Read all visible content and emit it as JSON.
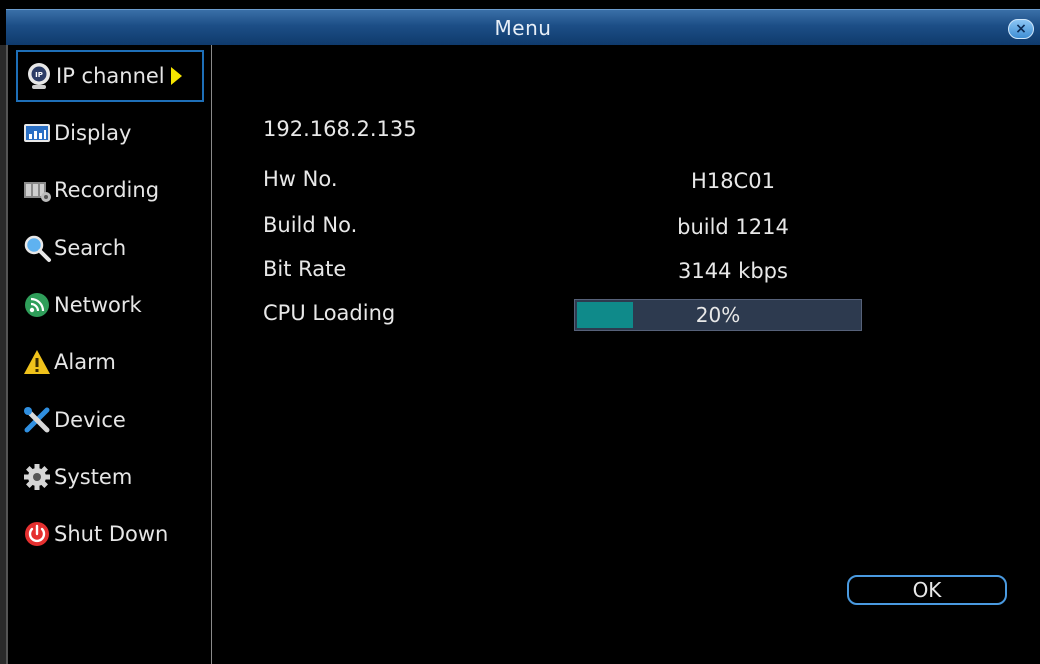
{
  "window": {
    "title": "Menu",
    "close_label": "×"
  },
  "sidebar": {
    "items": [
      {
        "label": "IP channel",
        "icon": "ip-camera-icon",
        "active": true
      },
      {
        "label": "Display",
        "icon": "display-icon"
      },
      {
        "label": "Recording",
        "icon": "recording-icon"
      },
      {
        "label": "Search",
        "icon": "search-icon"
      },
      {
        "label": "Network",
        "icon": "network-icon"
      },
      {
        "label": "Alarm",
        "icon": "alarm-icon"
      },
      {
        "label": "Device",
        "icon": "device-icon"
      },
      {
        "label": "System",
        "icon": "system-icon"
      },
      {
        "label": "Shut Down",
        "icon": "power-icon"
      }
    ]
  },
  "main": {
    "ip_address": "192.168.2.135",
    "hw_label": "Hw No.",
    "hw_value": "H18C01",
    "build_label": "Build No.",
    "build_value": "build 1214",
    "bitrate_label": "Bit Rate",
    "bitrate_value": "3144 kbps",
    "cpu_label": "CPU Loading",
    "cpu_percent_text": "20%",
    "cpu_percent": 20,
    "ok_label": "OK"
  },
  "colors": {
    "titlebar": "#1c4e86",
    "active_border": "#1e6fb8",
    "progress_fill": "#0f8a8a",
    "progress_track": "#2d3a4f",
    "arrow": "#f5e400"
  }
}
